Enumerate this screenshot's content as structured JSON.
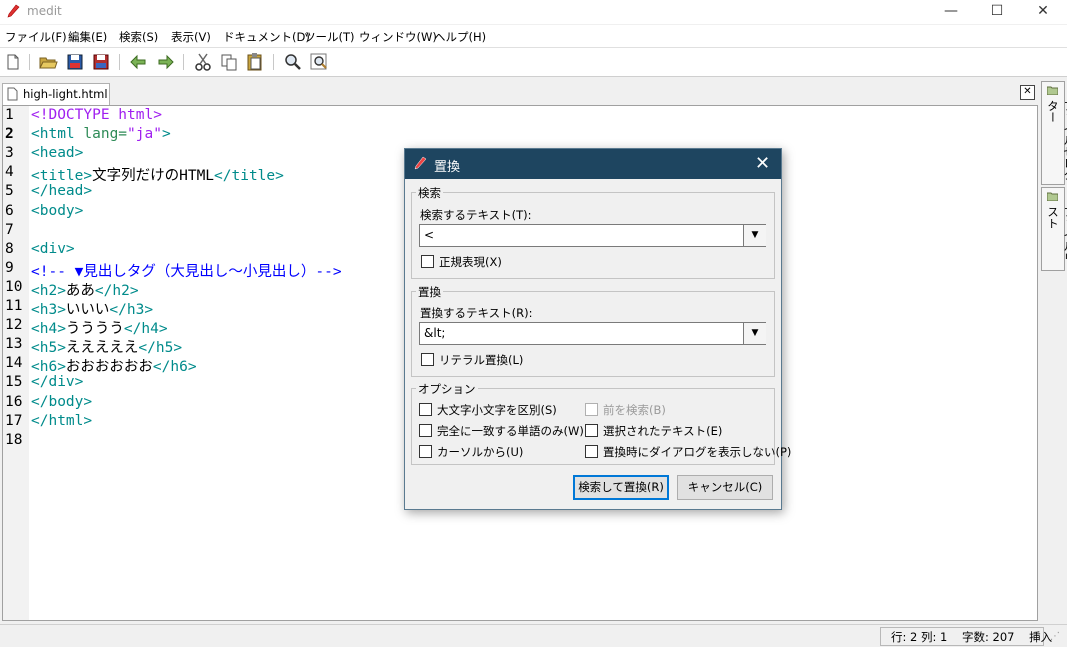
{
  "window": {
    "title": "medit",
    "minimize": "—",
    "maximize": "☐",
    "close": "✕"
  },
  "menu": [
    "ファイル(F)",
    "編集(E)",
    "検索(S)",
    "表示(V)",
    "ドキュメント(D)",
    "ツール(T)",
    "ウィンドウ(W)",
    "ヘルプ(H)"
  ],
  "toolbar": [
    "new-file-icon",
    "open-folder-icon",
    "save-icon",
    "save-as-icon",
    "undo-icon",
    "redo-icon",
    "cut-icon",
    "copy-icon",
    "paste-icon",
    "search-icon",
    "replace-icon"
  ],
  "tab": {
    "label": "high-light.html",
    "close": "✕"
  },
  "code": {
    "line_numbers": [
      "1",
      "2",
      "3",
      "4",
      "5",
      "6",
      "7",
      "8",
      "9",
      "10",
      "11",
      "12",
      "13",
      "14",
      "15",
      "16",
      "17",
      "18"
    ],
    "lines": [
      [
        [
          "doc",
          "<!DOCTYPE html>"
        ]
      ],
      [
        [
          "tag",
          "<html "
        ],
        [
          "attr",
          "lang="
        ],
        [
          "str",
          "\"ja\""
        ],
        [
          "tag",
          ">"
        ]
      ],
      [
        [
          "tag",
          "<head>"
        ]
      ],
      [
        [
          "tag",
          "<title>"
        ],
        [
          "txt",
          "文字列だけのHTML"
        ],
        [
          "tag",
          "</title>"
        ]
      ],
      [
        [
          "tag",
          "</head>"
        ]
      ],
      [
        [
          "tag",
          "<body>"
        ]
      ],
      [],
      [
        [
          "tag",
          "<div>"
        ]
      ],
      [
        [
          "cmt",
          "<!-- ▼見出しタグ（大見出し～小見出し）-->"
        ]
      ],
      [
        [
          "tag",
          "<h2>"
        ],
        [
          "txt",
          "ああ"
        ],
        [
          "tag",
          "</h2>"
        ]
      ],
      [
        [
          "tag",
          "<h3>"
        ],
        [
          "txt",
          "いいい"
        ],
        [
          "tag",
          "</h3>"
        ]
      ],
      [
        [
          "tag",
          "<h4>"
        ],
        [
          "txt",
          "うううう"
        ],
        [
          "tag",
          "</h4>"
        ]
      ],
      [
        [
          "tag",
          "<h5>"
        ],
        [
          "txt",
          "えええええ"
        ],
        [
          "tag",
          "</h5>"
        ]
      ],
      [
        [
          "tag",
          "<h6>"
        ],
        [
          "txt",
          "おおおおおお"
        ],
        [
          "tag",
          "</h6>"
        ]
      ],
      [
        [
          "tag",
          "</div>"
        ]
      ],
      [
        [
          "tag",
          "</body>"
        ]
      ],
      [
        [
          "tag",
          "</html>"
        ]
      ],
      []
    ]
  },
  "side_panel": {
    "file_selector": "ファイルセレクター",
    "file_list": "ファイルリスト"
  },
  "status": {
    "text": "行: 2 列: 1    字数: 207    挿入"
  },
  "dialog": {
    "title": "置換",
    "close": "✕",
    "search_group": "検索",
    "search_label": "検索するテキスト(T):",
    "search_value": "<",
    "regex_label": "正規表現(X)",
    "replace_group": "置換",
    "replace_label": "置換するテキスト(R):",
    "replace_value": "&lt;",
    "literal_label": "リテラル置換(L)",
    "options_group": "オプション",
    "case_label": "大文字小文字を区別(S)",
    "backward_label": "前を検索(B)",
    "whole_word_label": "完全に一致する単語のみ(W)",
    "selected_label": "選択されたテキスト(E)",
    "from_cursor_label": "カーソルから(U)",
    "no_prompt_label": "置換時にダイアログを表示しない(P)",
    "find_replace_button": "検索して置換(R)",
    "cancel_button": "キャンセル(C)"
  }
}
